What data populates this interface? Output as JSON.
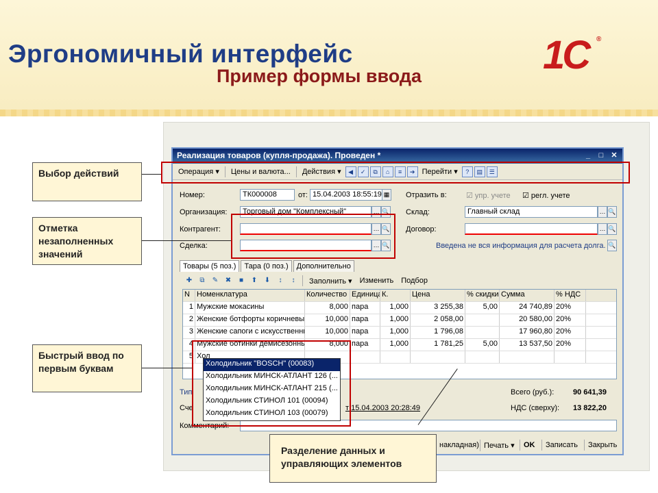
{
  "slide": {
    "title": "Эргономичный интерфейс",
    "subtitle": "Пример формы ввода",
    "logo_text": "1С"
  },
  "window": {
    "title": "Реализация товаров (купля-продажа). Проведен *",
    "toolbar": {
      "operation": "Операция ▾",
      "prices": "Цены и валюта...",
      "actions": "Действия ▾",
      "goto": "Перейти ▾",
      "help": "?"
    },
    "form": {
      "number_label": "Номер:",
      "number_value": "ТК000008",
      "date_label": "от:",
      "date_value": "15.04.2003 18:55:19",
      "reflect_label": "Отразить в:",
      "upr_label": "упр. учете",
      "regl_label": "регл. учете",
      "org_label": "Организация:",
      "org_value": "Торговый дом \"Комплексный\"",
      "warehouse_label": "Склад:",
      "warehouse_value": "Главный склад",
      "contractor_label": "Контрагент:",
      "contract_label": "Договор:",
      "deal_label": "Сделка:",
      "debt_notice": "Введена не вся информация для расчета долга."
    },
    "tabs": [
      "Товары (5 поз.)",
      "Тара (0 поз.)",
      "Дополнительно"
    ],
    "grid_toolbar": {
      "fill": "Заполнить ▾",
      "change": "Изменить",
      "pick": "Подбор"
    },
    "grid_headers": [
      "N",
      "Номенклатура",
      "Количество",
      "Единица",
      "К.",
      "Цена",
      "% скидки",
      "Сумма",
      "% НДС"
    ],
    "grid_rows": [
      [
        "1",
        "Мужские мокасины",
        "8,000",
        "пара",
        "1,000",
        "3 255,38",
        "5,00",
        "24 740,89",
        "20%"
      ],
      [
        "2",
        "Женские ботфорты коричневые",
        "10,000",
        "пара",
        "1,000",
        "2 058,00",
        "",
        "20 580,00",
        "20%"
      ],
      [
        "3",
        "Женские сапоги с искусственны...",
        "10,000",
        "пара",
        "1,000",
        "1 796,08",
        "",
        "17 960,80",
        "20%"
      ],
      [
        "4",
        "Мужские ботинки демисезонные",
        "8,000",
        "пара",
        "1,000",
        "1 781,25",
        "5,00",
        "13 537,50",
        "20%"
      ],
      [
        "5",
        "Хол",
        "",
        "",
        "",
        "",
        "",
        "",
        ""
      ]
    ],
    "dropdown": [
      "Холодильник \"BOSCH\" (00083)",
      "Холодильник МИНСК-АТЛАНТ 126 (...",
      "Холодильник МИНСК-АТЛАНТ 215 (...",
      "Холодильник СТИНОЛ 101 (00094)",
      "Холодильник СТИНОЛ 103 (00079)"
    ],
    "totals": {
      "total_label": "Всего (руб.):",
      "total_value": "90 641,39",
      "vat_label": "НДС (сверху):",
      "vat_value": "13 822,20"
    },
    "type_label": "Тип",
    "invoice_label": "Сче",
    "invoice_ref": "т 15.04.2003 20:28:49",
    "comment_label": "Комментарий:",
    "footer": {
      "waybill": "накладная)",
      "print": "Печать ▾",
      "ok": "OK",
      "save": "Записать",
      "close": "Закрыть"
    }
  },
  "callouts": {
    "actions": "Выбор действий",
    "unfilled": "Отметка незаполненных значений",
    "quick_input": "Быстрый ввод по первым буквам",
    "separation": "Разделение данных и управляющих элементов"
  },
  "colors": {
    "accent": "#c00000",
    "title": "#1f3d86",
    "subtitle": "#8b1a1a",
    "callout_bg": "#fff6d6"
  }
}
